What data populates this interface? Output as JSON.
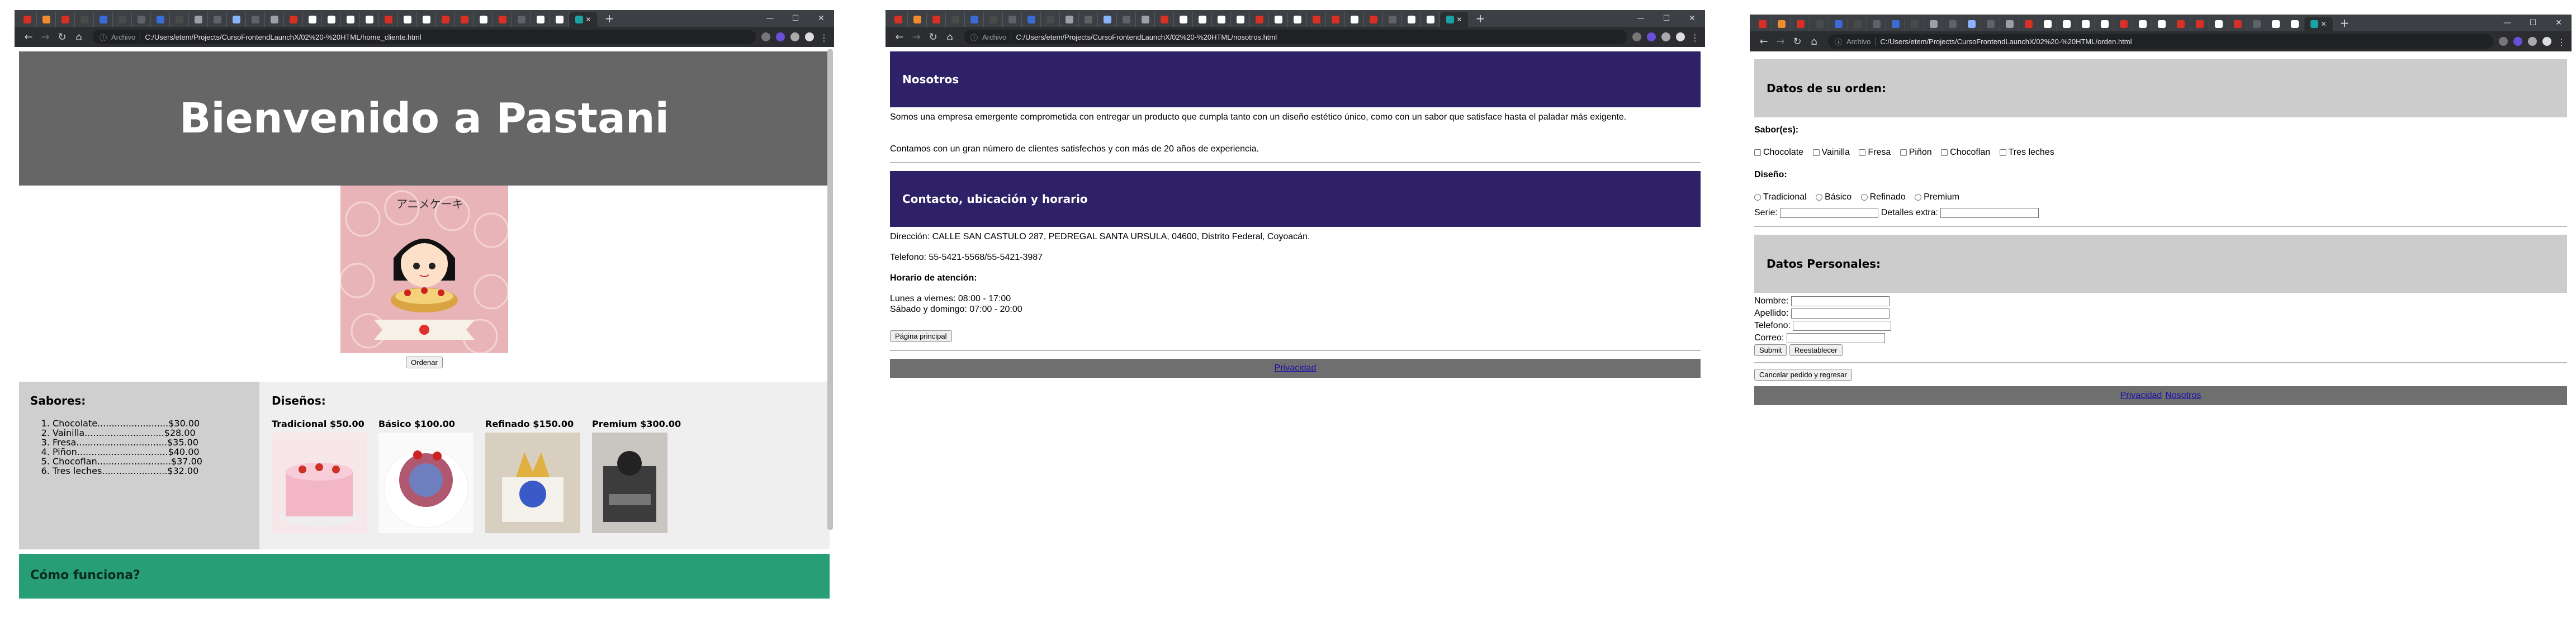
{
  "browser": {
    "window_controls": [
      "—",
      "☐",
      "✕"
    ],
    "new_tab": "+",
    "tab_close": "✕",
    "tab_favicon_colors": [
      "#d93025",
      "#f28b30",
      "#d93025",
      "#4a4a4a",
      "#3b6bd6",
      "#4a4a4a",
      "#5f6368",
      "#3b6bd6",
      "#4a4a4a",
      "#9aa0a6",
      "#5f6368",
      "#8ab4f8",
      "#5f6368",
      "#9aa0a6",
      "#d93025",
      "#ffffff",
      "#ffffff",
      "#ffffff",
      "#ffffff",
      "#d93025",
      "#ffffff",
      "#ffffff",
      "#d93025",
      "#d93025",
      "#ffffff",
      "#d93025",
      "#5f6368",
      "#ffffff",
      "#ffffff",
      "#1aa3a3"
    ],
    "nav": {
      "back": "←",
      "forward": "→",
      "reload": "↻",
      "home": "⌂"
    },
    "address_prefix": "Archivo"
  },
  "windows": [
    {
      "url": "C:/Users/etem/Projects/CursoFrontendLaunchX/02%20-%20HTML/home_cliente.html",
      "hero_title": "Bienvenido a Pastani",
      "mascot_text": "アニメケーキ",
      "order_button": "Ordenar",
      "sabores_title": "Sabores:",
      "sabores": [
        "Chocolate.........................$30.00",
        "Vainilla............................$28.00",
        "Fresa................................$35.00",
        "Piñon................................$40.00",
        "Chocoflan..........................$37.00",
        "Tres leches.......................$32.00"
      ],
      "disenos_title": "Diseños:",
      "disenos": [
        {
          "label": "Tradicional $50.00",
          "color": "#e8a0b4"
        },
        {
          "label": "Básico $100.00",
          "color": "#b05870"
        },
        {
          "label": "Refinado $150.00",
          "color": "#e0b040"
        },
        {
          "label": "Premium $300.00",
          "color": "#3c3c3c"
        }
      ],
      "howto_title": "Cómo funciona?"
    },
    {
      "url": "C:/Users/etem/Projects/CursoFrontendLaunchX/02%20-%20HTML/nosotros.html",
      "nosotros_title": "Nosotros",
      "nosotros_p1": "Somos una empresa emergente comprometida con entregar un producto que cumpla tanto con un diseño estético único, como con un sabor que satisface hasta el paladar más exigente.",
      "nosotros_p2": "Contamos con un gran número de clientes satisfechos y con más de 20 años de experiencia.",
      "contacto_title": "Contacto, ubicación y horario",
      "direccion": "Dirección: CALLE SAN CASTULO 287, PEDREGAL SANTA URSULA, 04600, Distrito Federal, Coyoacán.",
      "telefono": "Telefono: 55-5421-5568/55-5421-3987",
      "horario_title": "Horario de atención:",
      "horario_l1": "Lunes a viernes: 08:00 - 17:00",
      "horario_l2": "Sábado y domingo: 07:00 - 20:00",
      "main_button": "Página principal",
      "privacidad": "Privacidad"
    },
    {
      "url": "C:/Users/etem/Projects/CursoFrontendLaunchX/02%20-%20HTML/orden.html",
      "orden_title": "Datos de su orden:",
      "sabores_label": "Sabor(es):",
      "sabores": [
        "Chocolate",
        "Vainilla",
        "Fresa",
        "Piñon",
        "Chocoflan",
        "Tres leches"
      ],
      "diseno_label": "Diseño:",
      "disenos": [
        "Tradicional",
        "Básico",
        "Refinado",
        "Premium"
      ],
      "serie_label": "Serie:",
      "extras_label": "Detalles extra:",
      "personales_title": "Datos Personales:",
      "nombre_label": "Nombre:",
      "apellido_label": "Apellido:",
      "telefono_label": "Telefono:",
      "correo_label": "Correo:",
      "submit": "Submit",
      "reset": "Reestablecer",
      "cancel": "Cancelar pedido y regresar",
      "privacidad": "Privacidad",
      "nosotros": "Nosotros"
    }
  ]
}
